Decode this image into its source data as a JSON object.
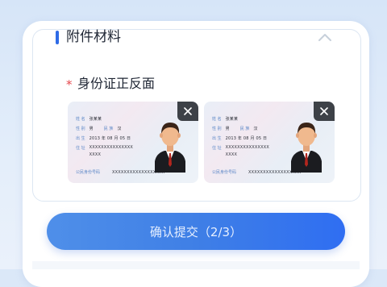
{
  "section": {
    "title": "附件材料"
  },
  "field": {
    "required_mark": "*",
    "label": "身份证正反面"
  },
  "cards": [
    {
      "name_label": "姓 名",
      "name_value": "张某某",
      "sex_label": "性 别",
      "sex_value": "男",
      "ethnic_label": "民 族",
      "ethnic_value": "汉",
      "birth_label": "出 生",
      "birth_value": "2013 年 08 月 05 日",
      "addr_label": "住 址",
      "addr_line1": "XXXXXXXXXXXXXXX",
      "addr_line2": "XXXX",
      "id_label": "公民身份号码",
      "id_value": "XXXXXXXXXXXXXXXXXX"
    },
    {
      "name_label": "姓 名",
      "name_value": "张某某",
      "sex_label": "性 别",
      "sex_value": "男",
      "ethnic_label": "民 族",
      "ethnic_value": "汉",
      "birth_label": "出 生",
      "birth_value": "2013 年 08 月 05 日",
      "addr_label": "住 址",
      "addr_line1": "XXXXXXXXXXXXXXX",
      "addr_line2": "XXXX",
      "id_label": "公民身份号码",
      "id_value": "XXXXXXXXXXXXXXXXXX"
    }
  ],
  "confirm": {
    "label": "确认提交（2/3）"
  },
  "colors": {
    "accent": "#2f6be6",
    "required": "#e5484d",
    "button_start": "#4f8fe9",
    "button_end": "#2f6ef2"
  },
  "icons": {
    "collapse": "chevron-up-icon",
    "remove": "close-icon",
    "portrait": "avatar-icon"
  }
}
